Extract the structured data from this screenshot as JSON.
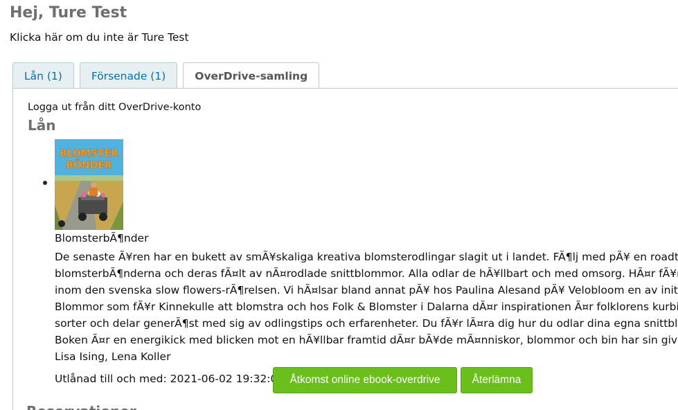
{
  "header": {
    "greeting": "Hej, Ture Test",
    "not_you_link": "Klicka här om du inte är Ture Test"
  },
  "tabs": [
    {
      "label": "Lån (1)",
      "active": false
    },
    {
      "label": "Försenade (1)",
      "active": false
    },
    {
      "label": "OverDrive-samling",
      "active": true
    }
  ],
  "overdrive": {
    "logout_text": "Logga ut från ditt OverDrive-konto",
    "section_title": "Lån",
    "next_section_title": "Reservationer",
    "colors": {
      "button": "#6bbf1a",
      "link": "#0a6ea6",
      "heading": "#6f6f6f"
    },
    "item": {
      "cover_title_line1": "BLOMSTER",
      "cover_title_line2": "BÖNDER",
      "title": "BlomsterbÃ¶nder",
      "description_lines": [
        "De senaste Ã¥ren har en bukett av smÃ¥skaliga kreativa blomsterodlingar slagit ut i landet. FÃ¶lj med pÃ¥ en roadtrip fr",
        "blomsterbÃ¶nderna och deras fÃ¤lt av nÃ¤rodlade snittblommor. Alla odlar de hÃ¥llbart och med omsorg. HÃ¤r fÃ¥r du",
        "inom den svenska slow flowers-rÃ¶relsen. Vi hÃ¤lsar bland annat pÃ¥ hos Paulina Alesand pÃ¥ Velobloom en av initiativ",
        "Blommor som fÃ¥r Kinnekulle att blomstra och hos Folk & Blomster i Dalarna dÃ¤r inspirationen Ã¤r folklorens kurbitsbl",
        "sorter och delar generÃ¶st med sig av odlingstips och erfarenheter. Du fÃ¥r lÃ¤ra dig hur du odlar dina egna snittblomm",
        "Boken Ã¤r en energikick med blicken mot en hÃ¥llbar framtid dÃ¤r bÃ¥de mÃ¤nniskor, blommor och bin har sin givna p",
        "Lisa Ising, Lena Koller"
      ],
      "due_text": "Utlånad till och med: 2021-06-02 19:32:00",
      "online_button": "Åtkomst online ebook-overdrive",
      "return_button": "Återlämna"
    }
  }
}
